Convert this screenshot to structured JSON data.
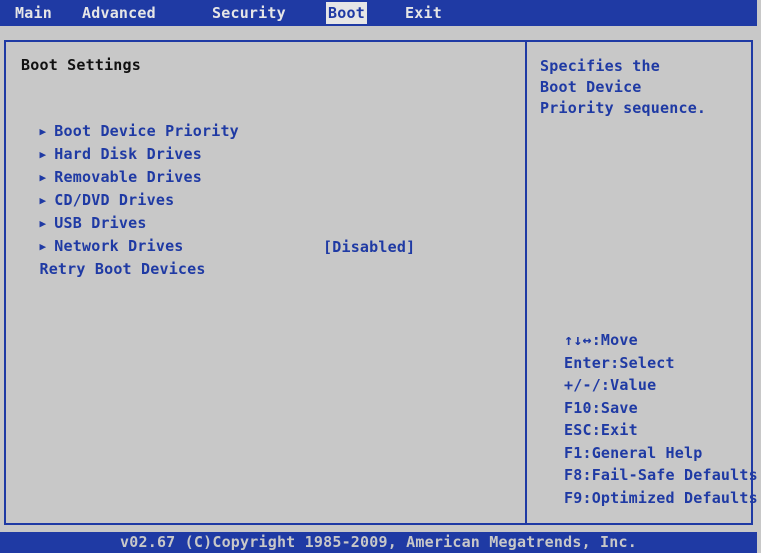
{
  "menu": {
    "items": [
      {
        "label": "Main"
      },
      {
        "label": "Advanced"
      },
      {
        "label": "Security"
      },
      {
        "label": "Boot",
        "active": true
      },
      {
        "label": "Exit"
      }
    ]
  },
  "panel": {
    "title": "Boot Settings",
    "options": [
      {
        "label": "Boot Device Priority",
        "submenu": true
      },
      {
        "label": "Hard Disk Drives",
        "submenu": true
      },
      {
        "label": "Removable Drives",
        "submenu": true
      },
      {
        "label": "CD/DVD Drives",
        "submenu": true
      },
      {
        "label": "USB Drives",
        "submenu": true
      },
      {
        "label": "Network Drives",
        "submenu": true
      },
      {
        "label": "Retry Boot Devices",
        "value": "[Disabled]"
      }
    ]
  },
  "help": {
    "lines": [
      "Specifies the",
      "Boot Device",
      "Priority sequence."
    ]
  },
  "keys": [
    "↑↓↔:Move",
    "Enter:Select",
    "+/-/:Value",
    "F10:Save",
    "ESC:Exit",
    "F1:General Help",
    "F8:Fail-Safe Defaults",
    "F9:Optimized Defaults"
  ],
  "footer": {
    "text": "v02.67 (C)Copyright 1985-2009, American Megatrends, Inc."
  },
  "colors": {
    "accent": "#1f3aa4",
    "background": "#c8c8c8",
    "highlight": "#e6e6e6"
  }
}
